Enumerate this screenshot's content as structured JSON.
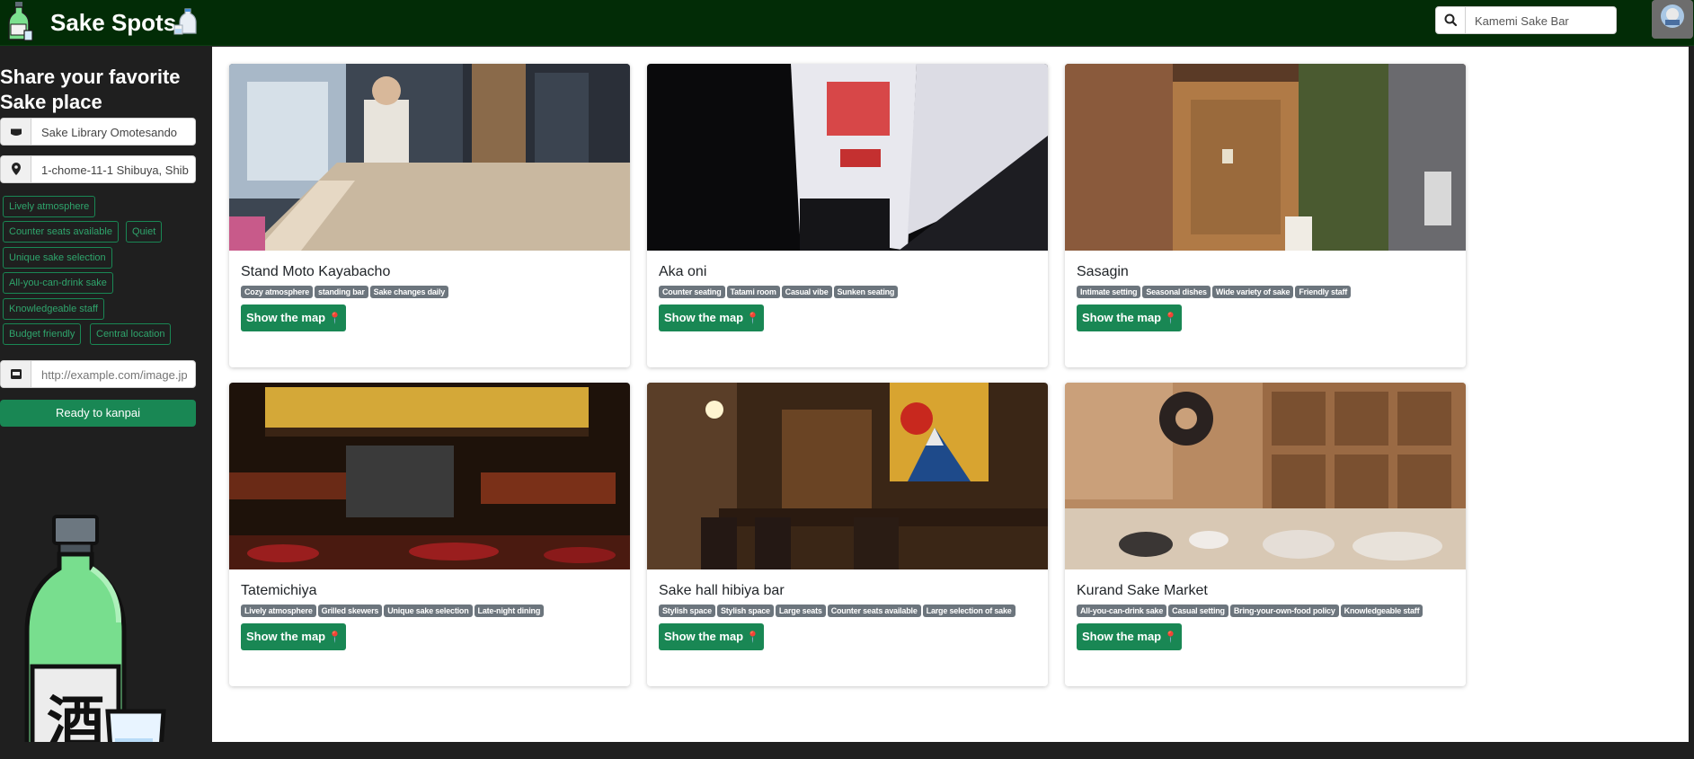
{
  "navbar": {
    "title": "Sake Spots",
    "search_value": "Kamemi Sake Bar",
    "colors": {
      "background": "#022c06",
      "accent": "#198754"
    },
    "icons": {
      "brand_left": "sake-bottle-icon",
      "brand_right": "sake-tokkuri-icon",
      "search": "search-icon",
      "avatar": "user-avatar"
    }
  },
  "sidebar": {
    "title": "Share your favorite Sake place",
    "name_field_value": "Sake Library Omotesando",
    "address_field_value": "1-chome-11-1 Shibuya, Shib",
    "image_field_placeholder": "http://example.com/image.jp",
    "tags": [
      "Lively atmosphere",
      "Counter seats available",
      "Quiet",
      "Unique sake selection",
      "All-you-can-drink sake",
      "Knowledgeable staff",
      "Budget friendly",
      "Central location"
    ],
    "submit_label": "Ready to kanpai",
    "illustration_kanji": "酒"
  },
  "cards": [
    {
      "name": "Stand Moto Kayabacho",
      "tags": [
        "Cozy atmosphere",
        "standing bar",
        "Sake changes daily"
      ],
      "button": "Show the map"
    },
    {
      "name": "Aka oni",
      "tags": [
        "Counter seating",
        "Tatami room",
        "Casual vibe",
        "Sunken seating"
      ],
      "button": "Show the map"
    },
    {
      "name": "Sasagin",
      "tags": [
        "Intimate setting",
        "Seasonal dishes",
        "Wide variety of sake",
        "Friendly staff"
      ],
      "button": "Show the map"
    },
    {
      "name": "Tatemichiya",
      "tags": [
        "Lively atmosphere",
        "Grilled skewers",
        "Unique sake selection",
        "Late-night dining"
      ],
      "button": "Show the map"
    },
    {
      "name": "Sake hall hibiya bar",
      "tags": [
        "Stylish space",
        "Stylish space",
        "Large seats",
        "Counter seats available",
        "Large selection of sake"
      ],
      "button": "Show the map"
    },
    {
      "name": "Kurand Sake Market",
      "tags": [
        "All-you-can-drink sake",
        "Casual setting",
        "Bring-your-own-food policy",
        "Knowledgeable staff"
      ],
      "button": "Show the map"
    }
  ]
}
